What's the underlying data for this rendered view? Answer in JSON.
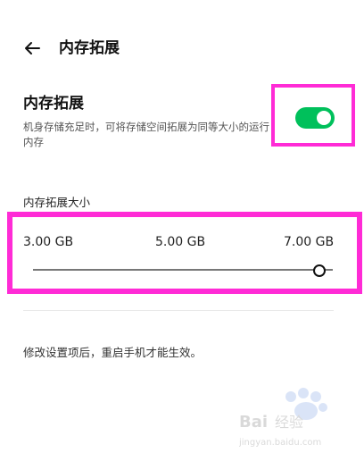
{
  "header": {
    "title": "内存拓展"
  },
  "section": {
    "title": "内存拓展",
    "description": "机身存储充足时，可将存储空间拓展为同等大小的运行内存",
    "toggle_on": true,
    "toggle_color": "#00c05b"
  },
  "size": {
    "label": "内存拓展大小",
    "ticks": [
      "3.00 GB",
      "5.00 GB",
      "7.00 GB"
    ],
    "selected": "7.00 GB"
  },
  "note": "修改设置项后，重启手机才能生效。",
  "watermark": {
    "text": "Bai 经验",
    "url": "jingyan.baidu.com"
  },
  "colors": {
    "highlight": "#ff2bd6"
  }
}
